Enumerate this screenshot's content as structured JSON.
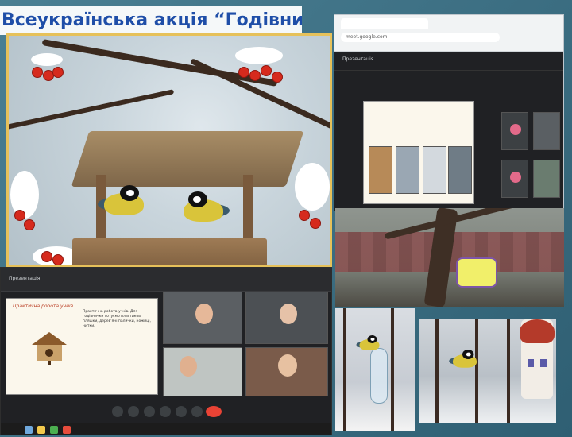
{
  "title": "Всеукраїнська акція “Годівничка”",
  "screens": {
    "top": {
      "url": "meet.google.com",
      "header": "Презентація",
      "slide_text": "",
      "tile_labels": [
        "",
        "",
        "",
        ""
      ]
    },
    "bottom": {
      "header": "Презентація",
      "slide_title": "Практична робота учнів",
      "slide_text": "Практична робота учнів. Для годівнички готуємо пластикові пляшки, дерев'яні палички, ножиці, нитки.",
      "toolbar_time": ""
    }
  },
  "colors": {
    "title": "#1f4ea8",
    "frame_gold": "#e6c15a",
    "meet_bg": "#202124",
    "end_call": "#ea4335"
  }
}
